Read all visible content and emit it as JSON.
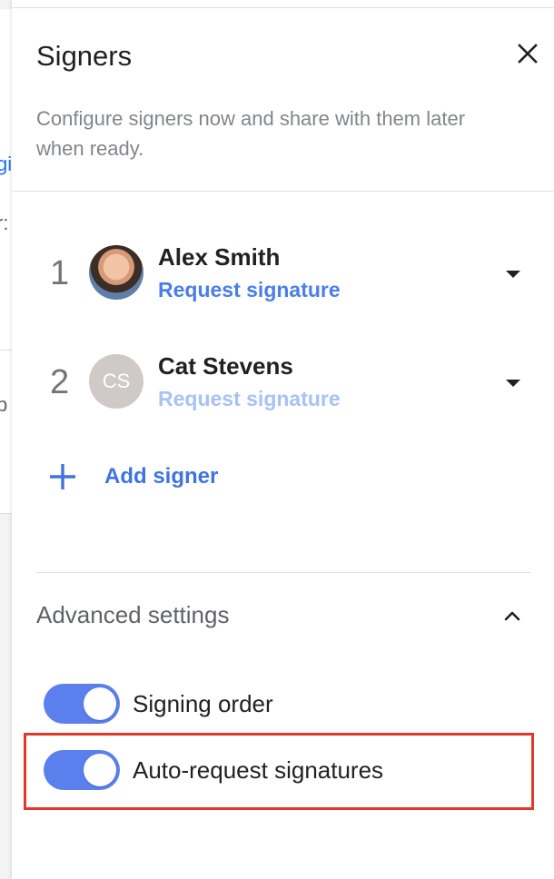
{
  "backdrop": {
    "fragments": [
      "gi",
      "r:",
      "p"
    ]
  },
  "panel": {
    "title": "Signers",
    "description": "Configure signers now and share with them later when ready.",
    "close_icon": "close-icon"
  },
  "signers": [
    {
      "number": "1",
      "name": "Alex Smith",
      "action": "Request signature",
      "avatar": "photo",
      "action_state": "enabled"
    },
    {
      "number": "2",
      "name": "Cat Stevens",
      "action": "Request signature",
      "avatar_initials": "CS",
      "action_state": "disabled"
    }
  ],
  "add_signer": {
    "label": "Add signer",
    "icon": "plus-icon"
  },
  "advanced": {
    "title": "Advanced settings",
    "expanded": true,
    "toggles": [
      {
        "label": "Signing order",
        "on": true
      },
      {
        "label": "Auto-request signatures",
        "on": true
      }
    ]
  },
  "colors": {
    "accent": "#4a7ee8",
    "accent_disabled": "#a8c2f3",
    "toggle_on": "#5b80ee",
    "highlight": "#e0392a"
  }
}
